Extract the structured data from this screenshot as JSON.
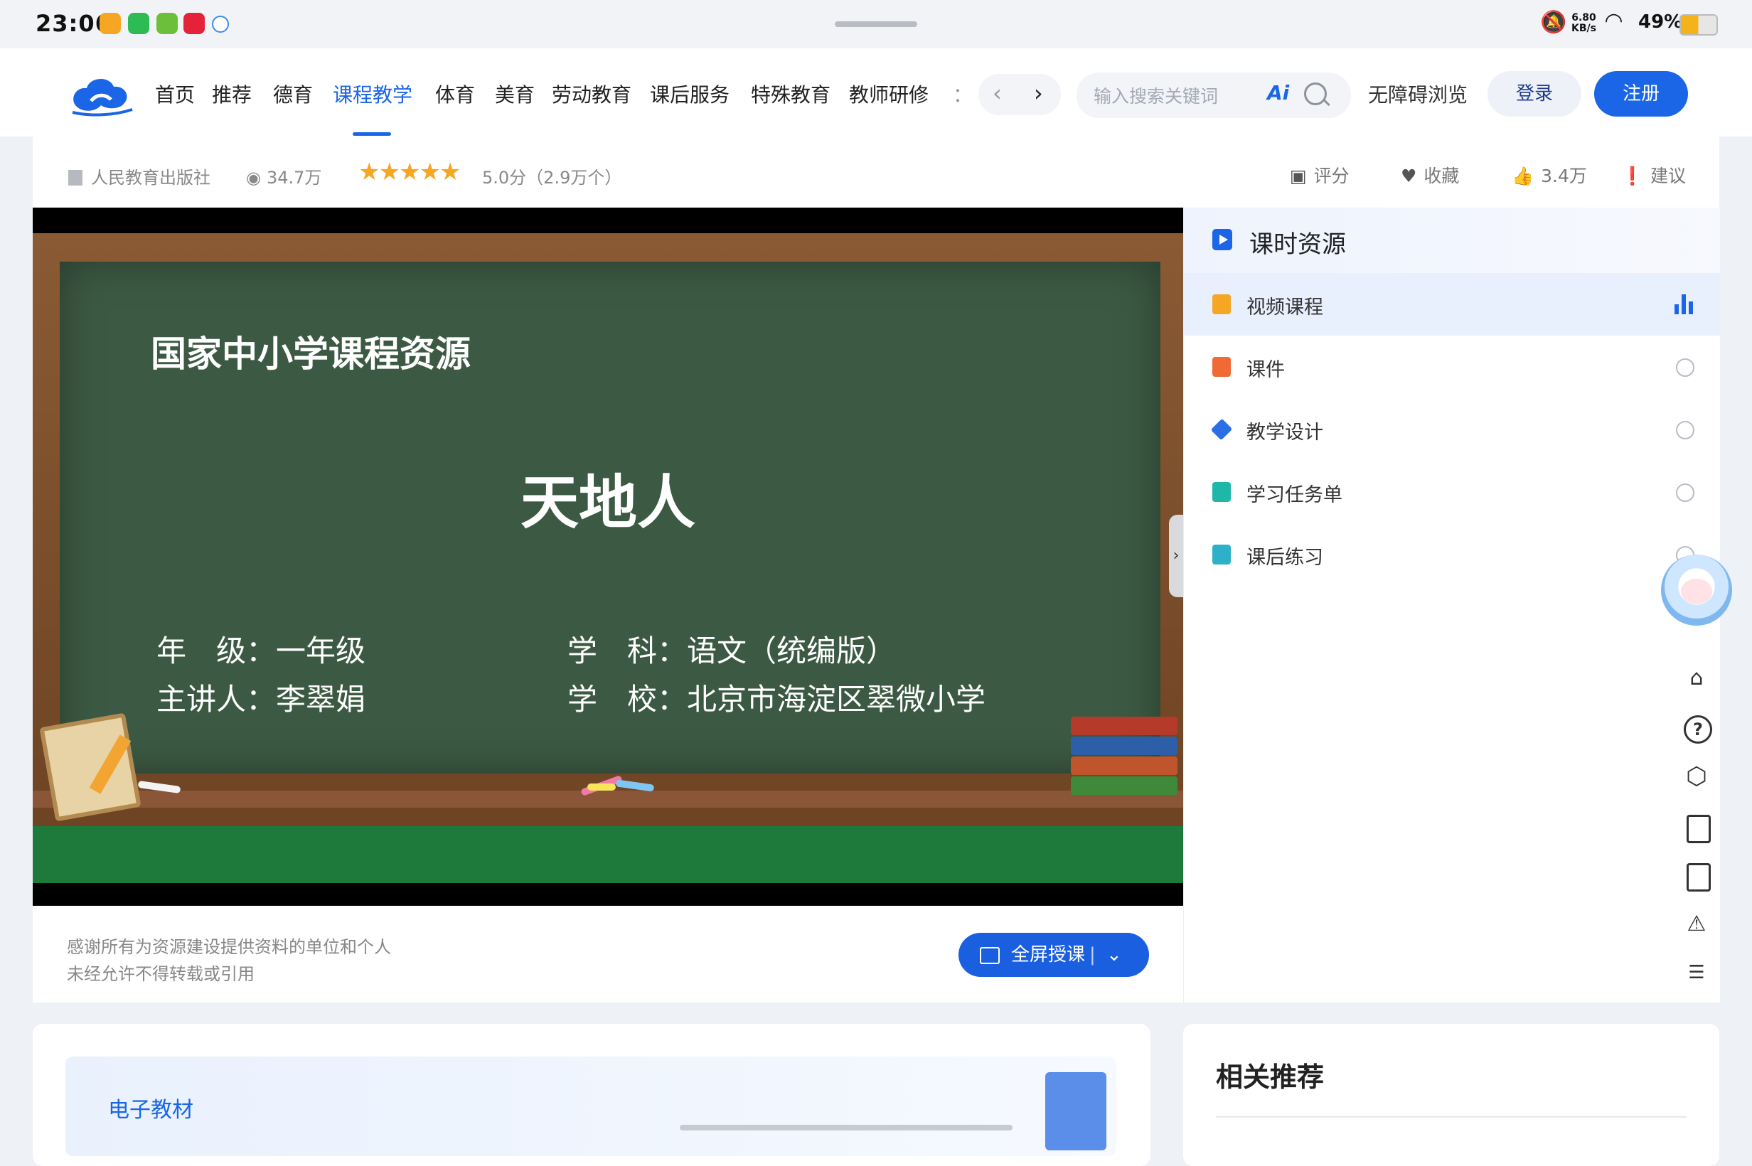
{
  "status_bar": {
    "time": "23:06",
    "net_speed_value": "6.80",
    "net_speed_unit": "KB/s",
    "battery": "49%"
  },
  "nav": {
    "items": [
      "首页",
      "推荐",
      "德育",
      "课程教学",
      "体育",
      "美育",
      "劳动教育",
      "课后服务",
      "特殊教育",
      "教师研修",
      "："
    ],
    "active_index": 3,
    "search_placeholder": "输入搜索关键词",
    "ai_label": "Ai",
    "accessible": "无障碍浏览",
    "login": "登录",
    "register": "注册",
    "accent_color": "#1a66e6"
  },
  "info": {
    "publisher": "人民教育出版社",
    "views": "34.7万",
    "stars": "★★★★★",
    "rating": "5.0分（2.9万个）",
    "rate_label": "评分",
    "favorite_label": "收藏",
    "likes": "3.4万",
    "suggest_label": "建议"
  },
  "video": {
    "caption": "国家中小学课程资源",
    "title": "天地人",
    "grade": "年　级：一年级",
    "subject": "学　科：语文（统编版）",
    "teacher": "主讲人：李翠娟",
    "school": "学　校：北京市海淀区翠微小学"
  },
  "footer_note": {
    "line1": "感谢所有为资源建设提供资料的单位和个人",
    "line2": "未经允许不得转载或引用",
    "fullscreen_label": "全屏授课",
    "separator": "|",
    "chevron": "⌄"
  },
  "sidebar": {
    "title": "课时资源",
    "items": [
      {
        "label": "视频课程",
        "color": "#f5a623"
      },
      {
        "label": "课件",
        "color": "#f06a35"
      },
      {
        "label": "教学设计",
        "color": "#2a6fe6"
      },
      {
        "label": "学习任务单",
        "color": "#1fb7a8"
      },
      {
        "label": "课后练习",
        "color": "#2fb0c9"
      }
    ]
  },
  "bottom": {
    "etext_label": "电子教材",
    "related_title": "相关推荐"
  }
}
